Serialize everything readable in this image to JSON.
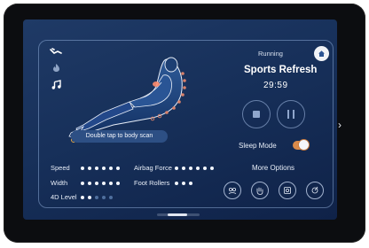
{
  "status": {
    "label": "Running"
  },
  "program": {
    "name": "Sports Refresh",
    "time": "29:59"
  },
  "scan": {
    "label": "Double tap to body scan"
  },
  "settings": [
    {
      "label": "Speed",
      "level": 6,
      "max": 6
    },
    {
      "label": "Width",
      "level": 6,
      "max": 6
    },
    {
      "label": "4D Level",
      "level": 2,
      "max": 5
    },
    {
      "label": "Airbag Force",
      "level": 6,
      "max": 6
    },
    {
      "label": "Foot Rollers",
      "level": 3,
      "max": 3
    }
  ],
  "sleep_mode": {
    "label": "Sleep Mode",
    "on": true
  },
  "more_options": {
    "label": "More Options",
    "icons": [
      "body-scan-icon",
      "hand-massage-icon",
      "camera-icon",
      "settings-icon"
    ]
  },
  "side_icons": [
    "recline-icon",
    "heat-icon",
    "music-icon"
  ],
  "colors": {
    "accent": "#d98a4a",
    "screen_bg": "#1a3360",
    "dot_on": "#f2f6ff",
    "dot_off": "#4f6f9e"
  }
}
